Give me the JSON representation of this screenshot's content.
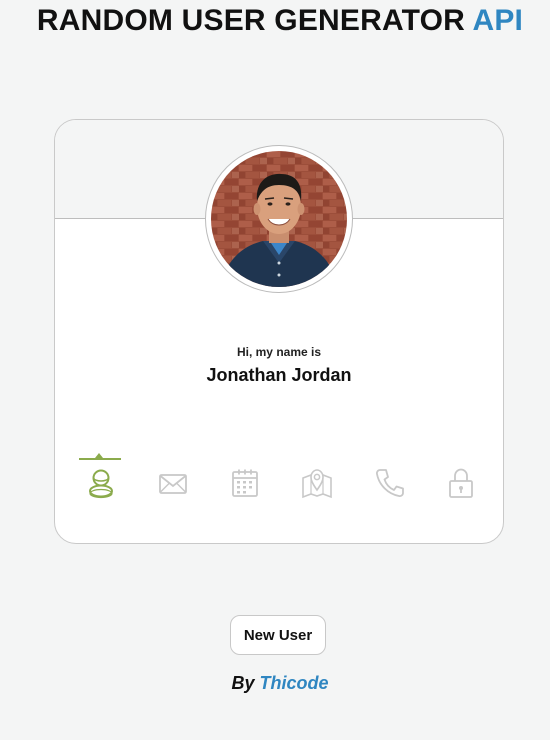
{
  "header": {
    "title_main": "RANDOM USER GENERATOR",
    "title_accent": "API",
    "accent_color": "#2f86c1"
  },
  "user_card": {
    "label": "Hi, my name is",
    "value": "Jonathan Jordan",
    "active_tab": "name",
    "tabs": [
      {
        "id": "name",
        "icon": "user-icon"
      },
      {
        "id": "email",
        "icon": "envelope-icon"
      },
      {
        "id": "birthday",
        "icon": "calendar-icon"
      },
      {
        "id": "location",
        "icon": "map-icon"
      },
      {
        "id": "phone",
        "icon": "phone-icon"
      },
      {
        "id": "password",
        "icon": "lock-icon"
      }
    ],
    "active_color": "#8bab4c",
    "inactive_color": "#c8c8c8"
  },
  "actions": {
    "new_user_label": "New User"
  },
  "footer": {
    "by_label": "By",
    "author": "Thicode"
  }
}
